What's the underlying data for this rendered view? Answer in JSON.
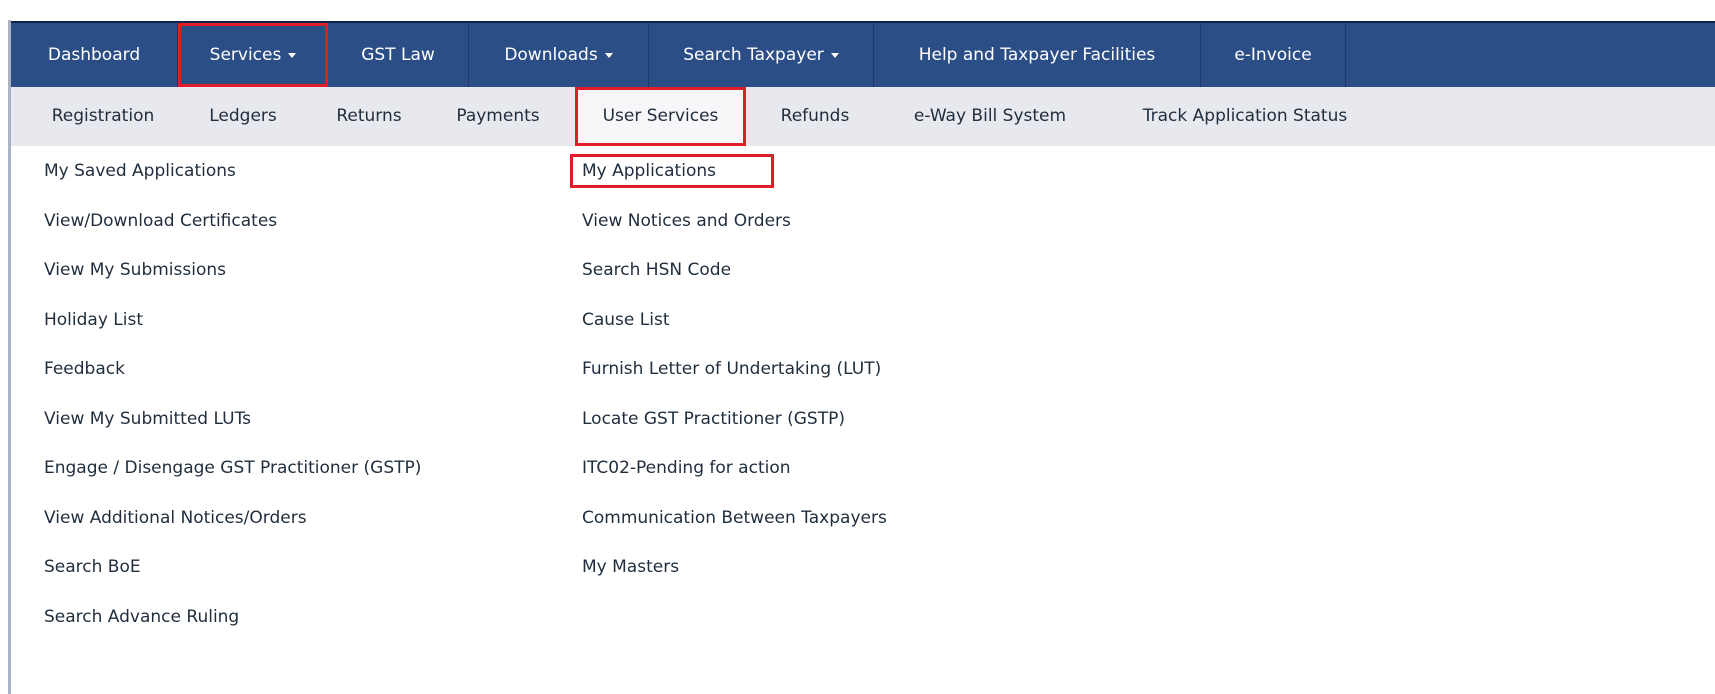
{
  "top_nav": {
    "items": [
      {
        "label": "Dashboard",
        "has_caret": false
      },
      {
        "label": "Services",
        "has_caret": true,
        "active": true
      },
      {
        "label": "GST Law",
        "has_caret": false
      },
      {
        "label": "Downloads",
        "has_caret": true
      },
      {
        "label": "Search Taxpayer",
        "has_caret": true
      },
      {
        "label": "Help and Taxpayer Facilities",
        "has_caret": false
      },
      {
        "label": "e-Invoice",
        "has_caret": false
      }
    ]
  },
  "sub_nav": {
    "items": [
      {
        "label": "Registration"
      },
      {
        "label": "Ledgers"
      },
      {
        "label": "Returns"
      },
      {
        "label": "Payments"
      },
      {
        "label": "User Services",
        "active": true
      },
      {
        "label": "Refunds"
      },
      {
        "label": "e-Way Bill System"
      },
      {
        "label": "Track Application Status"
      }
    ]
  },
  "menu": {
    "left_column": [
      "My Saved Applications",
      "View/Download Certificates",
      "View My Submissions",
      "Holiday List",
      "Feedback",
      "View My Submitted LUTs",
      "Engage / Disengage GST Practitioner (GSTP)",
      "View Additional Notices/Orders",
      "Search BoE",
      "Search Advance Ruling"
    ],
    "right_column": [
      "My Applications",
      "View Notices and Orders",
      "Search HSN Code",
      "Cause List",
      "Furnish Letter of Undertaking (LUT)",
      "Locate GST Practitioner (GSTP)",
      "ITC02-Pending for action",
      "Communication Between Taxpayers",
      "My Masters"
    ],
    "highlighted": "My Applications"
  },
  "colors": {
    "top_bar": "#2c4e86",
    "sub_bar": "#e7e9ee",
    "highlight_border": "#e11d2a",
    "text": "#1f2d3d"
  }
}
